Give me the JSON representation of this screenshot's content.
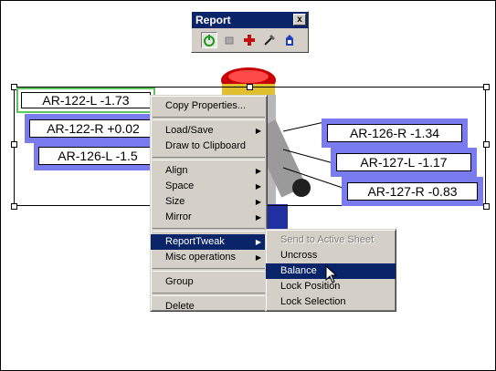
{
  "toolbar_window": {
    "title": "Report",
    "close_glyph": "x",
    "tools": [
      {
        "name": "power-icon",
        "pressed": true
      },
      {
        "name": "gray-square-icon",
        "pressed": false
      },
      {
        "name": "red-cross-icon",
        "pressed": false
      },
      {
        "name": "wand-icon",
        "pressed": false
      },
      {
        "name": "export-icon",
        "pressed": false
      }
    ]
  },
  "labels": {
    "l1": "AR-122-L -1.73",
    "l2": "AR-122-R +0.02",
    "l3": "AR-126-L -1.5",
    "r1": "AR-126-R -1.34",
    "r2": "AR-127-L -1.17",
    "r3": "AR-127-R -0.83"
  },
  "context_menu": {
    "copy_properties": "Copy Properties...",
    "load_save": "Load/Save",
    "draw_to_clipboard": "Draw to Clipboard",
    "align": "Align",
    "space": "Space",
    "size": "Size",
    "mirror": "Mirror",
    "report_tweak": "ReportTweak",
    "misc_operations": "Misc operations",
    "group": "Group",
    "delete": "Delete"
  },
  "submenu": {
    "send_to_active_sheet": "Send to Active Sheet",
    "uncross": "Uncross",
    "balance": "Balance",
    "lock_position": "Lock Position",
    "lock_selection": "Lock Selection"
  },
  "colors": {
    "menu_bg": "#d4d0c8",
    "highlight": "#0a246a",
    "label_blue": "#7b7bf0",
    "label_green": "#5ac85a"
  }
}
